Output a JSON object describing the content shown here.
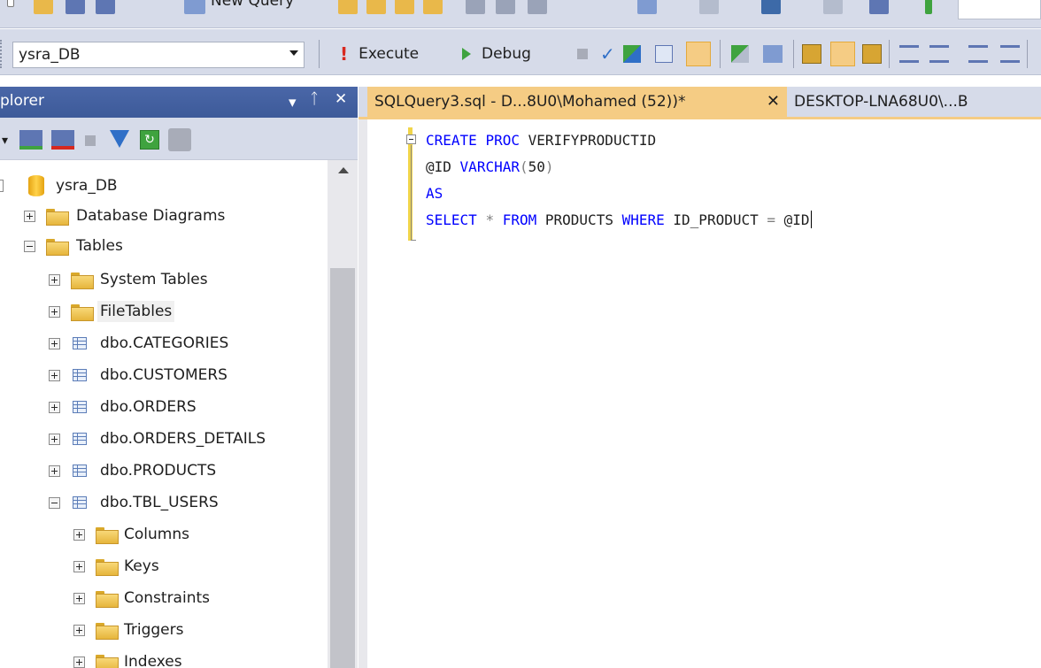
{
  "toolbar_top": {
    "new_query_label": "New Query"
  },
  "toolbar": {
    "database_selected": "ysra_DB",
    "execute_label": "Execute",
    "debug_label": "Debug"
  },
  "explorer": {
    "title": "plorer",
    "pin_glyph": "☰",
    "tree": {
      "database": "ysra_DB",
      "database_diagrams": "Database Diagrams",
      "tables": "Tables",
      "system_tables": "System Tables",
      "file_tables": "FileTables",
      "table_items": [
        "dbo.CATEGORIES",
        "dbo.CUSTOMERS",
        "dbo.ORDERS",
        "dbo.ORDERS_DETAILS",
        "dbo.PRODUCTS",
        "dbo.TBL_USERS"
      ],
      "tbl_users_children": [
        "Columns",
        "Keys",
        "Constraints",
        "Triggers",
        "Indexes"
      ]
    }
  },
  "tabs": {
    "active": "SQLQuery3.sql - D...8U0\\Mohamed (52))*",
    "close_glyph": "✕",
    "inactive": "DESKTOP-LNA68U0\\...B"
  },
  "code": {
    "line1_kw1": "CREATE",
    "line1_kw2": "PROC",
    "line1_name": "VERIFYPRODUCTID",
    "line2_param": "@ID",
    "line2_type": "VARCHAR",
    "line2_open": "(",
    "line2_size": "50",
    "line2_close": ")",
    "line3_kw": "AS",
    "line4_select": "SELECT",
    "line4_star": "*",
    "line4_from": "FROM",
    "line4_table": "PRODUCTS",
    "line4_where": "WHERE",
    "line4_col": "ID_PRODUCT",
    "line4_eq": "=",
    "line4_param": "@ID"
  },
  "colors": {
    "keyword": "#0000ff",
    "active_tab": "#f5cc84",
    "explorer_header": "#3d5a99",
    "toolbar_bg": "#d6dbe9"
  }
}
